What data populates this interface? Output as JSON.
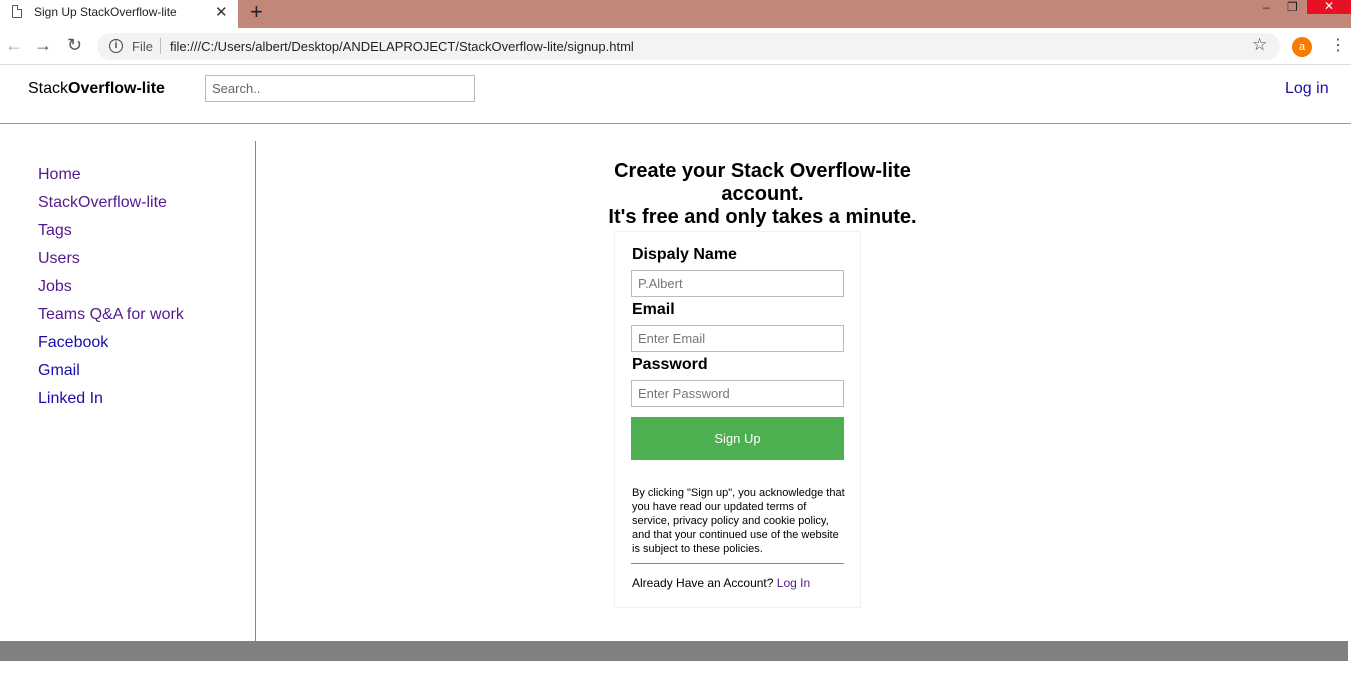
{
  "browser": {
    "tab_title": "Sign Up StackOverflow-lite",
    "tab_close": "✕",
    "new_tab": "+",
    "minimize": "–",
    "restore": "❐",
    "close": "✕",
    "back": "←",
    "forward": "→",
    "reload": "↻",
    "info": "i",
    "scheme": "File",
    "url": "file:///C:/Users/albert/Desktop/ANDELAPROJECT/StackOverflow-lite/signup.html",
    "star": "☆",
    "profile_initial": "a",
    "menu": "⋮"
  },
  "header": {
    "brand_prefix": "Stack",
    "brand_bold": "Overflow-lite",
    "search_placeholder": "Search..",
    "login_label": "Log in"
  },
  "sidebar": {
    "items": [
      {
        "label": "Home"
      },
      {
        "label": "StackOverflow-lite"
      },
      {
        "label": "Tags"
      },
      {
        "label": "Users"
      },
      {
        "label": "Jobs"
      },
      {
        "label": "Teams Q&A for work"
      },
      {
        "label": "Facebook"
      },
      {
        "label": "Gmail"
      },
      {
        "label": "Linked In"
      }
    ]
  },
  "form": {
    "heading_line1": "Create your Stack Overflow-lite account.",
    "heading_line2": "It's free and only takes a minute.",
    "name_label": "Dispaly Name",
    "name_placeholder": "P.Albert",
    "email_label": "Email",
    "email_placeholder": "Enter Email",
    "password_label": "Password",
    "password_placeholder": "Enter Password",
    "submit_label": "Sign Up",
    "terms": "By clicking \"Sign up\", you acknowledge that you have read our updated terms of service, privacy policy and cookie policy, and that your continued use of the website is subject to these policies.",
    "have_account": "Already Have an Account? ",
    "login_link": "Log In"
  },
  "colors": {
    "titlebar": "#c1887a",
    "signup_button": "#4caf50",
    "link_visited": "#551a8b",
    "link_unvisited": "#1a0dab",
    "footer": "#808080"
  }
}
